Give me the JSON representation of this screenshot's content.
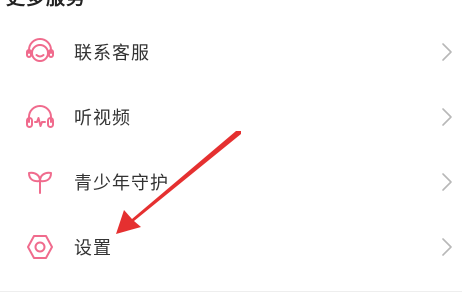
{
  "section": {
    "title": "更多服务"
  },
  "menu": {
    "items": [
      {
        "label": "联系客服",
        "icon": "headset-icon"
      },
      {
        "label": "听视频",
        "icon": "headphones-icon"
      },
      {
        "label": "青少年守护",
        "icon": "sprout-icon"
      },
      {
        "label": "设置",
        "icon": "gear-icon"
      }
    ]
  },
  "colors": {
    "accent": "#f06b8d",
    "text": "#333333",
    "chevron": "#b8b8b8",
    "arrow": "#e53030"
  }
}
